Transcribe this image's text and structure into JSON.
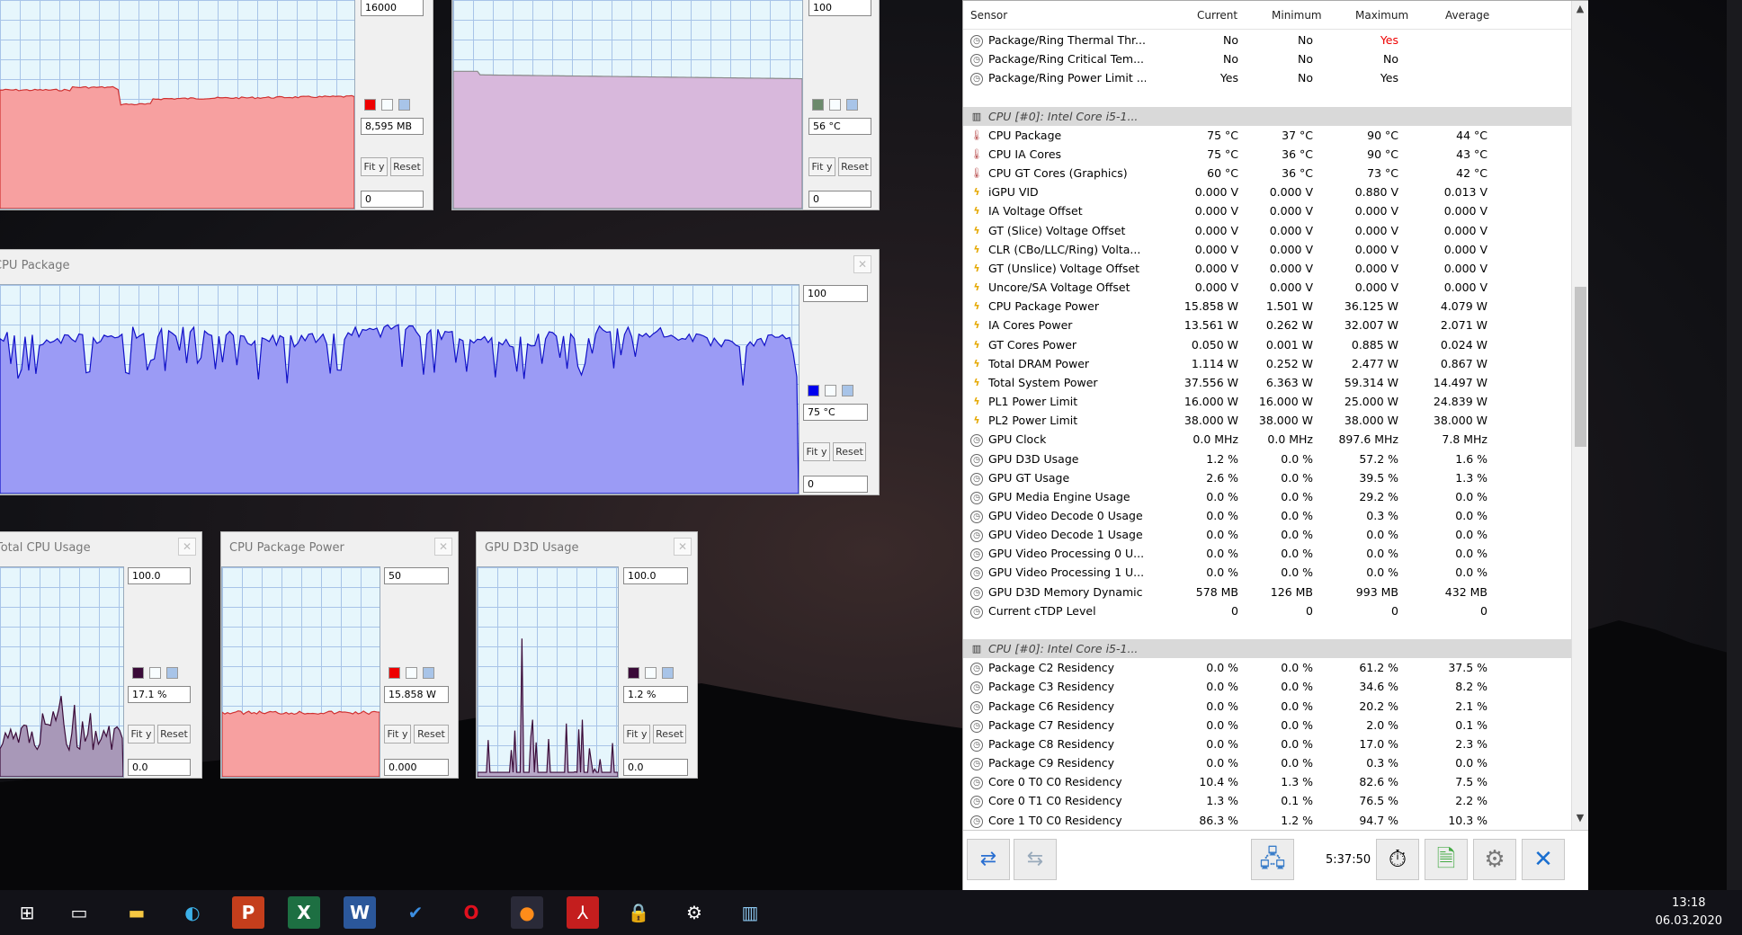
{
  "graphs": {
    "g1": {
      "top": "16000",
      "current": "8,595 MB",
      "bottom": "0",
      "fit": "Fit y",
      "reset": "Reset"
    },
    "g2": {
      "top": "100",
      "current": "56 °C",
      "bottom": "0",
      "fit": "Fit y",
      "reset": "Reset"
    },
    "g3": {
      "title": "CPU Package",
      "top": "100",
      "current": "75 °C",
      "bottom": "0",
      "fit": "Fit y",
      "reset": "Reset"
    },
    "g4": {
      "title": "Total CPU Usage",
      "top": "100.0",
      "current": "17.1 %",
      "bottom": "0.0",
      "fit": "Fit y",
      "reset": "Reset"
    },
    "g5": {
      "title": "CPU Package Power",
      "top": "50",
      "current": "15.858 W",
      "bottom": "0.000",
      "fit": "Fit y",
      "reset": "Reset"
    },
    "g6": {
      "title": "GPU D3D Usage",
      "top": "100.0",
      "current": "1.2 %",
      "bottom": "0.0",
      "fit": "Fit y",
      "reset": "Reset"
    }
  },
  "sensor_table": {
    "columns": [
      "Sensor",
      "Current",
      "Minimum",
      "Maximum",
      "Average"
    ],
    "rows": [
      {
        "icon": "clock",
        "name": "Package/Ring Thermal Thr...",
        "cur": "No",
        "min": "No",
        "max": "Yes",
        "avg": "",
        "max_red": true
      },
      {
        "icon": "clock",
        "name": "Package/Ring Critical Tem...",
        "cur": "No",
        "min": "No",
        "max": "No",
        "avg": ""
      },
      {
        "icon": "clock",
        "name": "Package/Ring Power Limit ...",
        "cur": "Yes",
        "min": "No",
        "max": "Yes",
        "avg": ""
      },
      {
        "icon": "none",
        "name": "",
        "cur": "",
        "min": "",
        "max": "",
        "avg": ""
      },
      {
        "icon": "chip",
        "name": "CPU [#0]: Intel Core i5-1...",
        "cur": "",
        "min": "",
        "max": "",
        "avg": "",
        "group": true
      },
      {
        "icon": "therm",
        "name": "CPU Package",
        "cur": "75 °C",
        "min": "37 °C",
        "max": "90 °C",
        "avg": "44 °C"
      },
      {
        "icon": "therm",
        "name": "CPU IA Cores",
        "cur": "75 °C",
        "min": "36 °C",
        "max": "90 °C",
        "avg": "43 °C"
      },
      {
        "icon": "therm",
        "name": "CPU GT Cores (Graphics)",
        "cur": "60 °C",
        "min": "36 °C",
        "max": "73 °C",
        "avg": "42 °C"
      },
      {
        "icon": "bolt",
        "name": "iGPU VID",
        "cur": "0.000 V",
        "min": "0.000 V",
        "max": "0.880 V",
        "avg": "0.013 V"
      },
      {
        "icon": "bolt",
        "name": "IA Voltage Offset",
        "cur": "0.000 V",
        "min": "0.000 V",
        "max": "0.000 V",
        "avg": "0.000 V"
      },
      {
        "icon": "bolt",
        "name": "GT (Slice) Voltage Offset",
        "cur": "0.000 V",
        "min": "0.000 V",
        "max": "0.000 V",
        "avg": "0.000 V"
      },
      {
        "icon": "bolt",
        "name": "CLR (CBo/LLC/Ring) Volta...",
        "cur": "0.000 V",
        "min": "0.000 V",
        "max": "0.000 V",
        "avg": "0.000 V"
      },
      {
        "icon": "bolt",
        "name": "GT (Unslice) Voltage Offset",
        "cur": "0.000 V",
        "min": "0.000 V",
        "max": "0.000 V",
        "avg": "0.000 V"
      },
      {
        "icon": "bolt",
        "name": "Uncore/SA Voltage Offset",
        "cur": "0.000 V",
        "min": "0.000 V",
        "max": "0.000 V",
        "avg": "0.000 V"
      },
      {
        "icon": "bolt",
        "name": "CPU Package Power",
        "cur": "15.858 W",
        "min": "1.501 W",
        "max": "36.125 W",
        "avg": "4.079 W"
      },
      {
        "icon": "bolt",
        "name": "IA Cores Power",
        "cur": "13.561 W",
        "min": "0.262 W",
        "max": "32.007 W",
        "avg": "2.071 W"
      },
      {
        "icon": "bolt",
        "name": "GT Cores Power",
        "cur": "0.050 W",
        "min": "0.001 W",
        "max": "0.885 W",
        "avg": "0.024 W"
      },
      {
        "icon": "bolt",
        "name": "Total DRAM Power",
        "cur": "1.114 W",
        "min": "0.252 W",
        "max": "2.477 W",
        "avg": "0.867 W"
      },
      {
        "icon": "bolt",
        "name": "Total System Power",
        "cur": "37.556 W",
        "min": "6.363 W",
        "max": "59.314 W",
        "avg": "14.497 W"
      },
      {
        "icon": "bolt",
        "name": "PL1 Power Limit",
        "cur": "16.000 W",
        "min": "16.000 W",
        "max": "25.000 W",
        "avg": "24.839 W"
      },
      {
        "icon": "bolt",
        "name": "PL2 Power Limit",
        "cur": "38.000 W",
        "min": "38.000 W",
        "max": "38.000 W",
        "avg": "38.000 W"
      },
      {
        "icon": "clock",
        "name": "GPU Clock",
        "cur": "0.0 MHz",
        "min": "0.0 MHz",
        "max": "897.6 MHz",
        "avg": "7.8 MHz"
      },
      {
        "icon": "clock",
        "name": "GPU D3D Usage",
        "cur": "1.2 %",
        "min": "0.0 %",
        "max": "57.2 %",
        "avg": "1.6 %"
      },
      {
        "icon": "clock",
        "name": "GPU GT Usage",
        "cur": "2.6 %",
        "min": "0.0 %",
        "max": "39.5 %",
        "avg": "1.3 %"
      },
      {
        "icon": "clock",
        "name": "GPU Media Engine Usage",
        "cur": "0.0 %",
        "min": "0.0 %",
        "max": "29.2 %",
        "avg": "0.0 %"
      },
      {
        "icon": "clock",
        "name": "GPU Video Decode 0 Usage",
        "cur": "0.0 %",
        "min": "0.0 %",
        "max": "0.3 %",
        "avg": "0.0 %"
      },
      {
        "icon": "clock",
        "name": "GPU Video Decode 1 Usage",
        "cur": "0.0 %",
        "min": "0.0 %",
        "max": "0.0 %",
        "avg": "0.0 %"
      },
      {
        "icon": "clock",
        "name": "GPU Video Processing 0 U...",
        "cur": "0.0 %",
        "min": "0.0 %",
        "max": "0.0 %",
        "avg": "0.0 %"
      },
      {
        "icon": "clock",
        "name": "GPU Video Processing 1 U...",
        "cur": "0.0 %",
        "min": "0.0 %",
        "max": "0.0 %",
        "avg": "0.0 %"
      },
      {
        "icon": "clock",
        "name": "GPU D3D Memory Dynamic",
        "cur": "578 MB",
        "min": "126 MB",
        "max": "993 MB",
        "avg": "432 MB"
      },
      {
        "icon": "clock",
        "name": "Current cTDP Level",
        "cur": "0",
        "min": "0",
        "max": "0",
        "avg": "0"
      },
      {
        "icon": "none",
        "name": "",
        "cur": "",
        "min": "",
        "max": "",
        "avg": ""
      },
      {
        "icon": "chip",
        "name": "CPU [#0]: Intel Core i5-1...",
        "cur": "",
        "min": "",
        "max": "",
        "avg": "",
        "group": true
      },
      {
        "icon": "clock",
        "name": "Package C2 Residency",
        "cur": "0.0 %",
        "min": "0.0 %",
        "max": "61.2 %",
        "avg": "37.5 %"
      },
      {
        "icon": "clock",
        "name": "Package C3 Residency",
        "cur": "0.0 %",
        "min": "0.0 %",
        "max": "34.6 %",
        "avg": "8.2 %"
      },
      {
        "icon": "clock",
        "name": "Package C6 Residency",
        "cur": "0.0 %",
        "min": "0.0 %",
        "max": "20.2 %",
        "avg": "2.1 %"
      },
      {
        "icon": "clock",
        "name": "Package C7 Residency",
        "cur": "0.0 %",
        "min": "0.0 %",
        "max": "2.0 %",
        "avg": "0.1 %"
      },
      {
        "icon": "clock",
        "name": "Package C8 Residency",
        "cur": "0.0 %",
        "min": "0.0 %",
        "max": "17.0 %",
        "avg": "2.3 %"
      },
      {
        "icon": "clock",
        "name": "Package C9 Residency",
        "cur": "0.0 %",
        "min": "0.0 %",
        "max": "0.3 %",
        "avg": "0.0 %"
      },
      {
        "icon": "clock",
        "name": "Core 0 T0 C0 Residency",
        "cur": "10.4 %",
        "min": "1.3 %",
        "max": "82.6 %",
        "avg": "7.5 %"
      },
      {
        "icon": "clock",
        "name": "Core 0 T1 C0 Residency",
        "cur": "1.3 %",
        "min": "0.1 %",
        "max": "76.5 %",
        "avg": "2.2 %"
      },
      {
        "icon": "clock",
        "name": "Core 1 T0 C0 Residency",
        "cur": "86.3 %",
        "min": "1.2 %",
        "max": "94.7 %",
        "avg": "10.3 %"
      }
    ]
  },
  "toolbar": {
    "elapsed": "5:37:50"
  },
  "taskbar": {
    "time": "13:18",
    "date": "06.03.2020"
  }
}
